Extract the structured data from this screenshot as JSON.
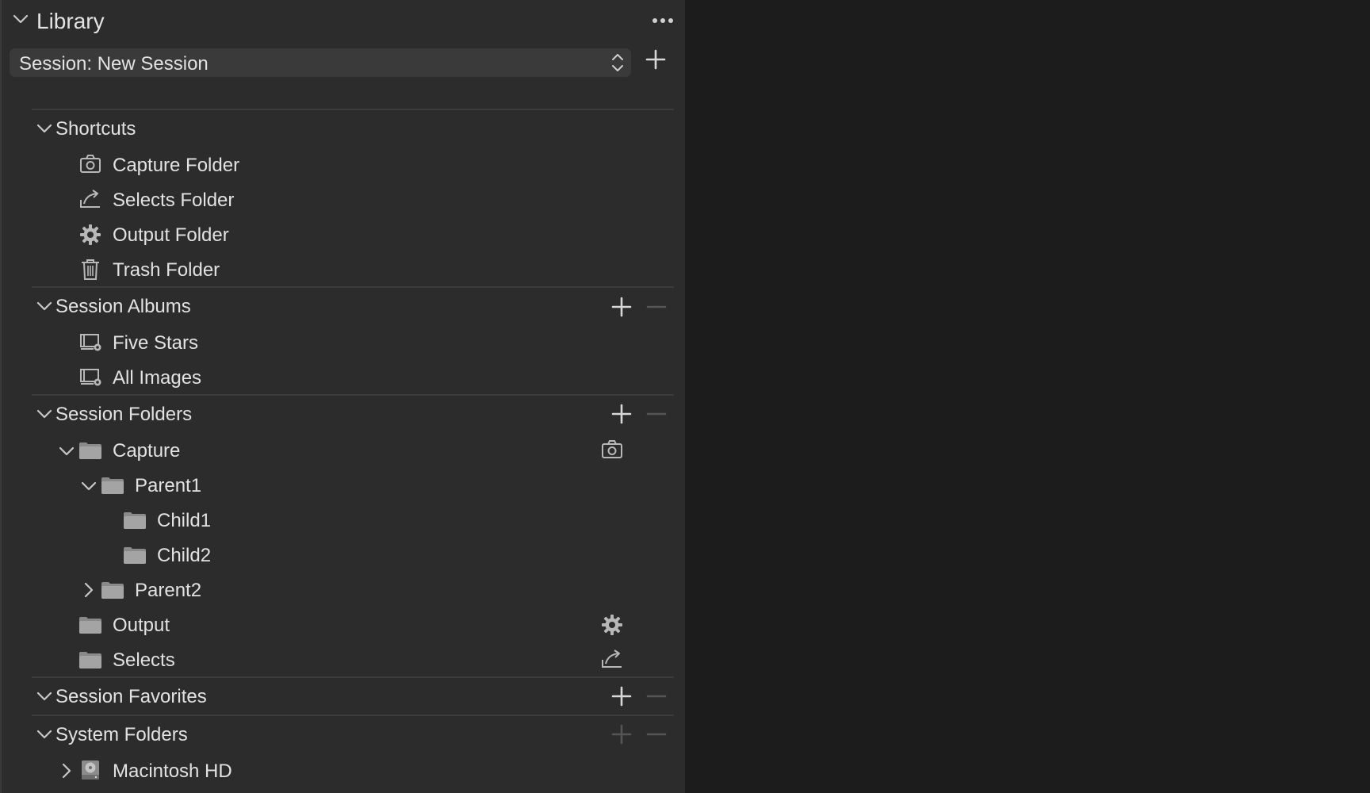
{
  "header": {
    "title": "Library",
    "more_icon": "ellipsis-icon"
  },
  "session_select": {
    "value": "Session: New Session",
    "add_icon": "plus-icon"
  },
  "shortcuts": {
    "title": "Shortcuts",
    "items": [
      {
        "label": "Capture Folder",
        "icon": "camera-icon"
      },
      {
        "label": "Selects Folder",
        "icon": "selects-icon"
      },
      {
        "label": "Output Folder",
        "icon": "gear-icon"
      },
      {
        "label": "Trash Folder",
        "icon": "trash-icon"
      }
    ]
  },
  "session_albums": {
    "title": "Session Albums",
    "items": [
      {
        "label": "Five Stars",
        "icon": "smart-album-icon"
      },
      {
        "label": "All Images",
        "icon": "smart-album-icon"
      }
    ]
  },
  "session_folders": {
    "title": "Session Folders",
    "items": [
      {
        "label": "Capture",
        "icon": "folder-icon",
        "badge": "camera-icon",
        "expanded": true
      },
      {
        "label": "Parent1",
        "icon": "folder-icon",
        "expanded": true
      },
      {
        "label": "Child1",
        "icon": "folder-icon"
      },
      {
        "label": "Child2",
        "icon": "folder-icon"
      },
      {
        "label": "Parent2",
        "icon": "folder-icon",
        "expanded": false
      },
      {
        "label": "Output",
        "icon": "folder-icon",
        "badge": "gear-icon"
      },
      {
        "label": "Selects",
        "icon": "folder-icon",
        "badge": "selects-icon"
      }
    ]
  },
  "session_favorites": {
    "title": "Session Favorites"
  },
  "system_folders": {
    "title": "System Folders",
    "items": [
      {
        "label": "Macintosh HD",
        "icon": "hard-drive-icon",
        "expanded": false
      }
    ]
  },
  "colors": {
    "panel_bg": "#2c2c2c",
    "window_bg": "#1c1c1c",
    "text": "#e2e2e2",
    "icon": "#b8b8b8",
    "disabled": "#5a5a5a"
  }
}
